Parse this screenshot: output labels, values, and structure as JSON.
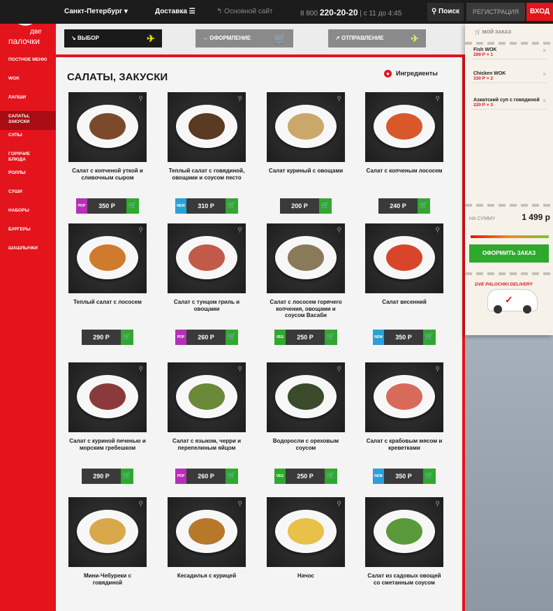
{
  "topbar": {
    "city": "Санкт-Петербург",
    "delivery": "Доставка",
    "main_site": "Основной сайт",
    "phone_prefix": "8 800",
    "phone_number": "220-20-20",
    "hours": "с 11 до 4:45",
    "search": "Поиск",
    "register": "РЕГИСТРАЦИЯ",
    "login": "ВХОД"
  },
  "logo": {
    "line1": "две",
    "line2": "палочки"
  },
  "sidebar": {
    "items": [
      {
        "label": "ПОСТНОЕ МЕНЮ"
      },
      {
        "label": "WOK"
      },
      {
        "label": "ЛАПШИ"
      },
      {
        "label": "САЛАТЫ, ЗАКУСКИ"
      },
      {
        "label": "СУПЫ"
      },
      {
        "label": "ГОРЯЧИЕ БЛЮДА"
      },
      {
        "label": "РОЛЛЫ"
      },
      {
        "label": "СУШИ"
      },
      {
        "label": "НАБОРЫ"
      },
      {
        "label": "БУРГЕРЫ"
      },
      {
        "label": "ШАШЛЫЧКИ"
      }
    ]
  },
  "steps": {
    "s1": "ВЫБОР",
    "s2": "ОФОРМЛЕНИЕ",
    "s3": "ОТПРАВЛЕНИЕ"
  },
  "page": {
    "title": "САЛАТЫ, ЗАКУСКИ",
    "ingredients": "Ингредиенты"
  },
  "products": [
    {
      "name": "Салат с копченой уткой и сливочным сыром",
      "badge": "POP",
      "price": "350 Р",
      "food_color": "#7a4a2a"
    },
    {
      "name": "Теплый салат с говядиной, овощами и соусом песто",
      "badge": "NEW",
      "price": "310 Р",
      "food_color": "#5a3a22"
    },
    {
      "name": "Салат куриный с овощами",
      "badge": "",
      "price": "200 Р",
      "food_color": "#c9a86a"
    },
    {
      "name": "Салат с копченым лососем",
      "badge": "",
      "price": "240 Р",
      "food_color": "#d8582a"
    },
    {
      "name": "Теплый салат с лососем",
      "badge": "",
      "price": "290 Р",
      "food_color": "#d07a2e"
    },
    {
      "name": "Салат с тунцом гриль и овощами",
      "badge": "POP",
      "price": "260 Р",
      "food_color": "#c25a4a"
    },
    {
      "name": "Салат с лососем горячего копчения, овощами и соусом Васаби",
      "badge": "VEG",
      "price": "250 Р",
      "food_color": "#8a7a5a"
    },
    {
      "name": "Салат весенний",
      "badge": "NEW",
      "price": "350 Р",
      "food_color": "#d8452a"
    },
    {
      "name": "Салат с куриной печенью и морским гребешком",
      "badge": "",
      "price": "290 Р",
      "food_color": "#8a3a3a"
    },
    {
      "name": "Салат с языком, черри и перепелиным яйцом",
      "badge": "POP",
      "price": "260 Р",
      "food_color": "#6a8a3a"
    },
    {
      "name": "Водоросли с ореховым соусом",
      "badge": "VEG",
      "price": "250 Р",
      "food_color": "#3a4a2a"
    },
    {
      "name": "Салат с крабовым мясом и креветками",
      "badge": "NEW",
      "price": "350 Р",
      "food_color": "#d86a5a"
    },
    {
      "name": "Мини-Чебуреки с говядиной",
      "badge": "",
      "price": "",
      "food_color": "#d9a84a"
    },
    {
      "name": "Кесадилья с курицей",
      "badge": "",
      "price": "",
      "food_color": "#b8782a"
    },
    {
      "name": "Начос",
      "badge": "",
      "price": "",
      "food_color": "#e8c04a"
    },
    {
      "name": "Салат из садовых овощей со сметанным соусом",
      "badge": "",
      "price": "",
      "food_color": "#5a9a3a"
    }
  ],
  "order": {
    "header": "МОЙ ЗАКАЗ",
    "items": [
      {
        "name": "Fish WOK",
        "price": "299 Р × 1"
      },
      {
        "name": "Chicken WOK",
        "price": "330 Р × 2"
      },
      {
        "name": "Азиатский суп с говядиной",
        "price": "220 Р × 3"
      }
    ],
    "sum_label": "НА СУММУ",
    "sum_value": "1 499 р",
    "checkout": "ОФОРМИТЬ ЗАКАЗ",
    "brand": "DVE PALOCHKI DELIVERY"
  },
  "colors": {
    "brand_red": "#e3141c",
    "cart_green": "#2fa82e",
    "badge_pop": "#b62fb8",
    "badge_new": "#2aa0d8",
    "badge_veg": "#2fa82e"
  }
}
